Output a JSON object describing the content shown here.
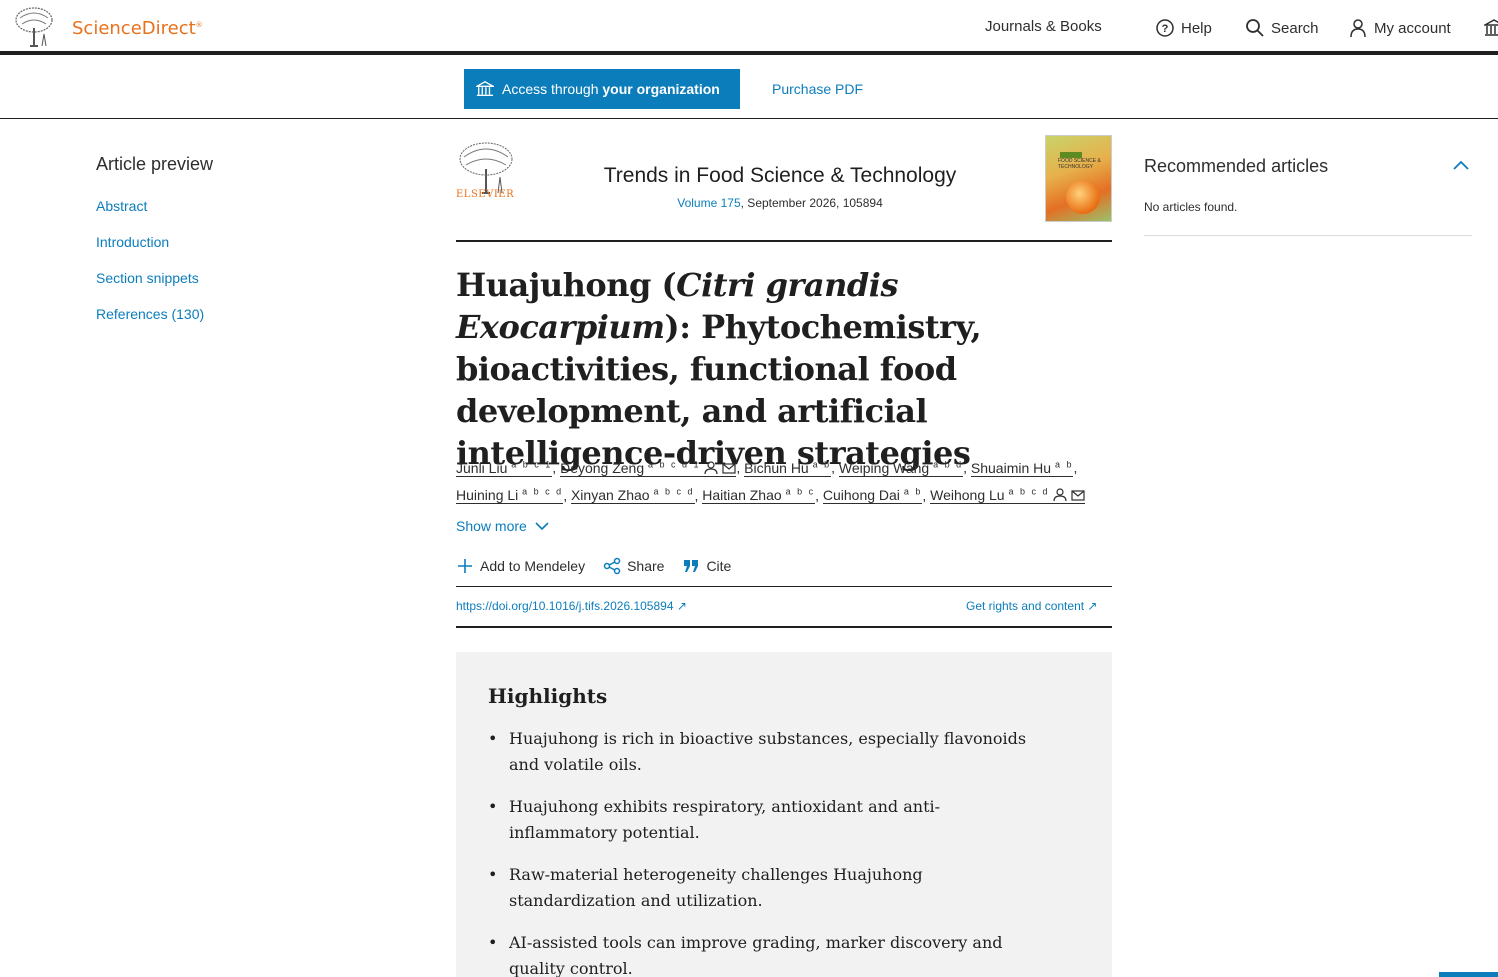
{
  "header": {
    "brand": "ScienceDirect",
    "nav": {
      "journals_books": "Journals & Books",
      "help": "Help",
      "search": "Search",
      "my_account": "My account"
    }
  },
  "access": {
    "access_prefix": "Access through ",
    "access_bold": "your organization",
    "purchase": "Purchase PDF"
  },
  "sidebar": {
    "title": "Article preview",
    "links": [
      "Abstract",
      "Introduction",
      "Section snippets",
      "References (130)"
    ]
  },
  "journal": {
    "publisher": "ELSEVIER",
    "title": "Trends in Food Science & Technology",
    "volume": "Volume 175",
    "issue_info": ", September 2026, 105894",
    "cover_text": "FOOD SCIENCE & TECHNOLOGY"
  },
  "article": {
    "title_part1": "Huajuhong (",
    "title_italic": "Citri grandis Exocarpium",
    "title_part2": "): Phytochemistry, bioactivities, functional food development, and artificial intelligence-driven strategies",
    "authors": [
      {
        "name": "Junli Liu",
        "sup": "a b c 1"
      },
      {
        "name": "Deyong Zeng",
        "sup": "a b c d 1"
      },
      {
        "name": "Bichun Hu",
        "sup": "a b"
      },
      {
        "name": "Weiping Wang",
        "sup": "a b d"
      },
      {
        "name": "Shuaimin Hu",
        "sup": "a b"
      },
      {
        "name": "Huining Li",
        "sup": "a b c d"
      },
      {
        "name": "Xinyan Zhao",
        "sup": "a b c d"
      },
      {
        "name": "Haitian Zhao",
        "sup": "a b c"
      },
      {
        "name": "Cuihong Dai",
        "sup": "a b"
      },
      {
        "name": "Weihong Lu",
        "sup": "a b c d"
      }
    ],
    "show_more": "Show more",
    "actions": {
      "mendeley": "Add to Mendeley",
      "share": "Share",
      "cite": "Cite"
    },
    "doi": "https://doi.org/10.1016/j.tifs.2026.105894",
    "rights": "Get rights and content"
  },
  "highlights": {
    "title": "Highlights",
    "items": [
      "Huajuhong is rich in bioactive substances, especially flavonoids and volatile oils.",
      "Huajuhong exhibits respiratory, antioxidant and anti-inflammatory potential.",
      "Raw-material heterogeneity challenges Huajuhong standardization and utilization.",
      "AI-assisted tools can improve grading, marker discovery and quality control."
    ]
  },
  "recommended": {
    "title": "Recommended articles",
    "empty": "No articles found."
  },
  "colors": {
    "brand_orange": "#e9711c",
    "link_blue": "#0c7dbb",
    "text": "#1f1f1f"
  }
}
